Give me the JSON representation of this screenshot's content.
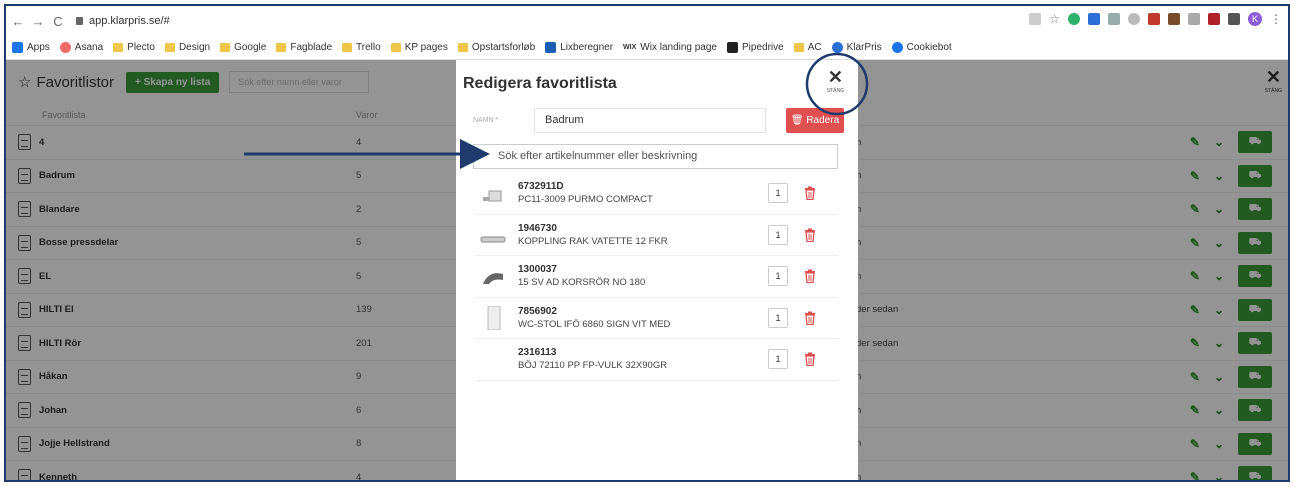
{
  "browser": {
    "url": "app.klarpris.se/#",
    "bookmarks": [
      "Apps",
      "Asana",
      "Plecto",
      "Design",
      "Google",
      "Fagblade",
      "Trello",
      "KP pages",
      "Opstartsforløb",
      "Lixberegner",
      "Wix landing page",
      "Pipedrive",
      "AC",
      "KlarPris",
      "Cookiebot"
    ],
    "profile_initial": "K"
  },
  "app": {
    "title": "Favoritlistor",
    "new_list_button": "+ Skapa ny lista",
    "search_placeholder": "Sök efter namn eller varor",
    "close_label": "STÄNG",
    "col_list": "Favoritlista",
    "col_items": "Varor",
    "rows": [
      {
        "name": "4",
        "count": "4",
        "note": "n"
      },
      {
        "name": "Badrum",
        "count": "5",
        "note": "n"
      },
      {
        "name": "Blandare",
        "count": "2",
        "note": "n"
      },
      {
        "name": "Bosse pressdelar",
        "count": "5",
        "note": "n"
      },
      {
        "name": "EL",
        "count": "5",
        "note": "n"
      },
      {
        "name": "HILTI El",
        "count": "139",
        "note": "der sedan"
      },
      {
        "name": "HILTI Rör",
        "count": "201",
        "note": "der sedan"
      },
      {
        "name": "Håkan",
        "count": "9",
        "note": "n"
      },
      {
        "name": "Johan",
        "count": "6",
        "note": "n"
      },
      {
        "name": "Jojje Hellstrand",
        "count": "8",
        "note": "n"
      },
      {
        "name": "Kenneth",
        "count": "4",
        "note": "n"
      }
    ]
  },
  "modal": {
    "title": "Redigera favoritlista",
    "close_label": "STÄNG",
    "name_label": "NAMN *",
    "name_value": "Badrum",
    "delete_button": "Radera",
    "search_placeholder": "Sök efter artikelnummer eller beskrivning",
    "items": [
      {
        "number": "6732911D",
        "desc": "PC11-3009 PURMO COMPACT",
        "qty": "1"
      },
      {
        "number": "1946730",
        "desc": "KOPPLING RAK VATETTE 12 FKR",
        "qty": "1"
      },
      {
        "number": "1300037",
        "desc": "15 SV AD KORSRÖR NO 180",
        "qty": "1"
      },
      {
        "number": "7856902",
        "desc": "WC-STOL IFÖ 6860 SIGN VIT MED",
        "qty": "1"
      },
      {
        "number": "2316113",
        "desc": "BÖJ 72110 PP FP-VULK 32X90GR",
        "qty": "1"
      }
    ]
  },
  "colors": {
    "accent_green": "#3c9b3c",
    "danger_red": "#e05050",
    "annotation_blue": "#1f3a6d"
  }
}
